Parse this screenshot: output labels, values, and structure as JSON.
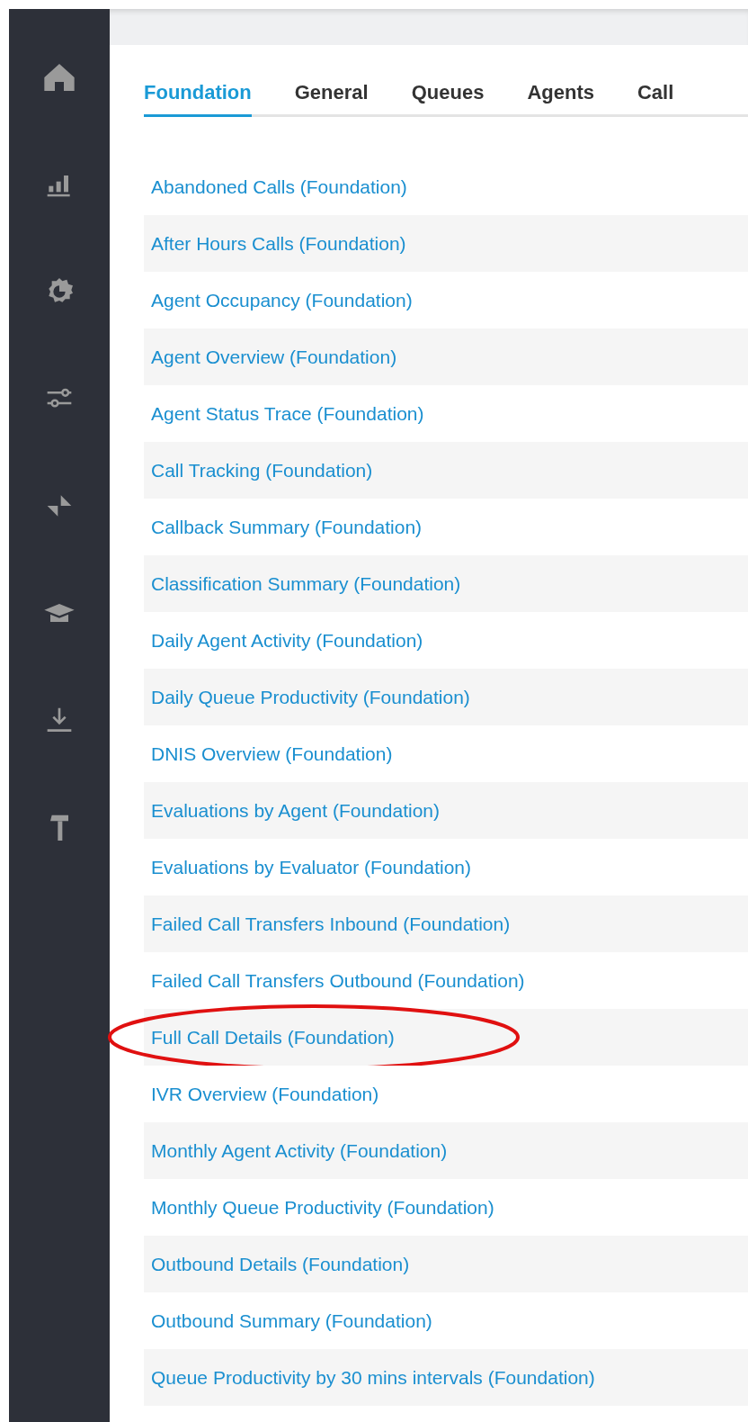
{
  "sidebar": {
    "items": [
      {
        "kind": "home"
      },
      {
        "kind": "chart"
      },
      {
        "kind": "gear"
      },
      {
        "kind": "sliders"
      },
      {
        "kind": "triangles"
      },
      {
        "kind": "cap"
      },
      {
        "kind": "download"
      },
      {
        "kind": "hammer"
      }
    ]
  },
  "tabs": [
    {
      "label": "Foundation",
      "selected": true
    },
    {
      "label": "General",
      "selected": false
    },
    {
      "label": "Queues",
      "selected": false
    },
    {
      "label": "Agents",
      "selected": false
    },
    {
      "label": "Call",
      "selected": false
    }
  ],
  "reports": [
    {
      "label": "Abandoned Calls (Foundation)",
      "circled": false
    },
    {
      "label": "After Hours Calls (Foundation)",
      "circled": false
    },
    {
      "label": "Agent Occupancy (Foundation)",
      "circled": false
    },
    {
      "label": "Agent Overview (Foundation)",
      "circled": false
    },
    {
      "label": "Agent Status Trace (Foundation)",
      "circled": false
    },
    {
      "label": "Call Tracking (Foundation)",
      "circled": false
    },
    {
      "label": "Callback Summary (Foundation)",
      "circled": false
    },
    {
      "label": "Classification Summary (Foundation)",
      "circled": false
    },
    {
      "label": "Daily Agent Activity (Foundation)",
      "circled": false
    },
    {
      "label": "Daily Queue Productivity (Foundation)",
      "circled": false
    },
    {
      "label": "DNIS Overview (Foundation)",
      "circled": false
    },
    {
      "label": "Evaluations by Agent (Foundation)",
      "circled": false
    },
    {
      "label": "Evaluations by Evaluator (Foundation)",
      "circled": false
    },
    {
      "label": "Failed Call Transfers Inbound (Foundation)",
      "circled": false
    },
    {
      "label": "Failed Call Transfers Outbound (Foundation)",
      "circled": false
    },
    {
      "label": "Full Call Details (Foundation)",
      "circled": true
    },
    {
      "label": "IVR Overview (Foundation)",
      "circled": false
    },
    {
      "label": "Monthly Agent Activity (Foundation)",
      "circled": false
    },
    {
      "label": "Monthly Queue Productivity (Foundation)",
      "circled": false
    },
    {
      "label": "Outbound Details (Foundation)",
      "circled": false
    },
    {
      "label": "Outbound Summary (Foundation)",
      "circled": false
    },
    {
      "label": "Queue Productivity by 30 mins intervals (Foundation)",
      "circled": false
    }
  ]
}
